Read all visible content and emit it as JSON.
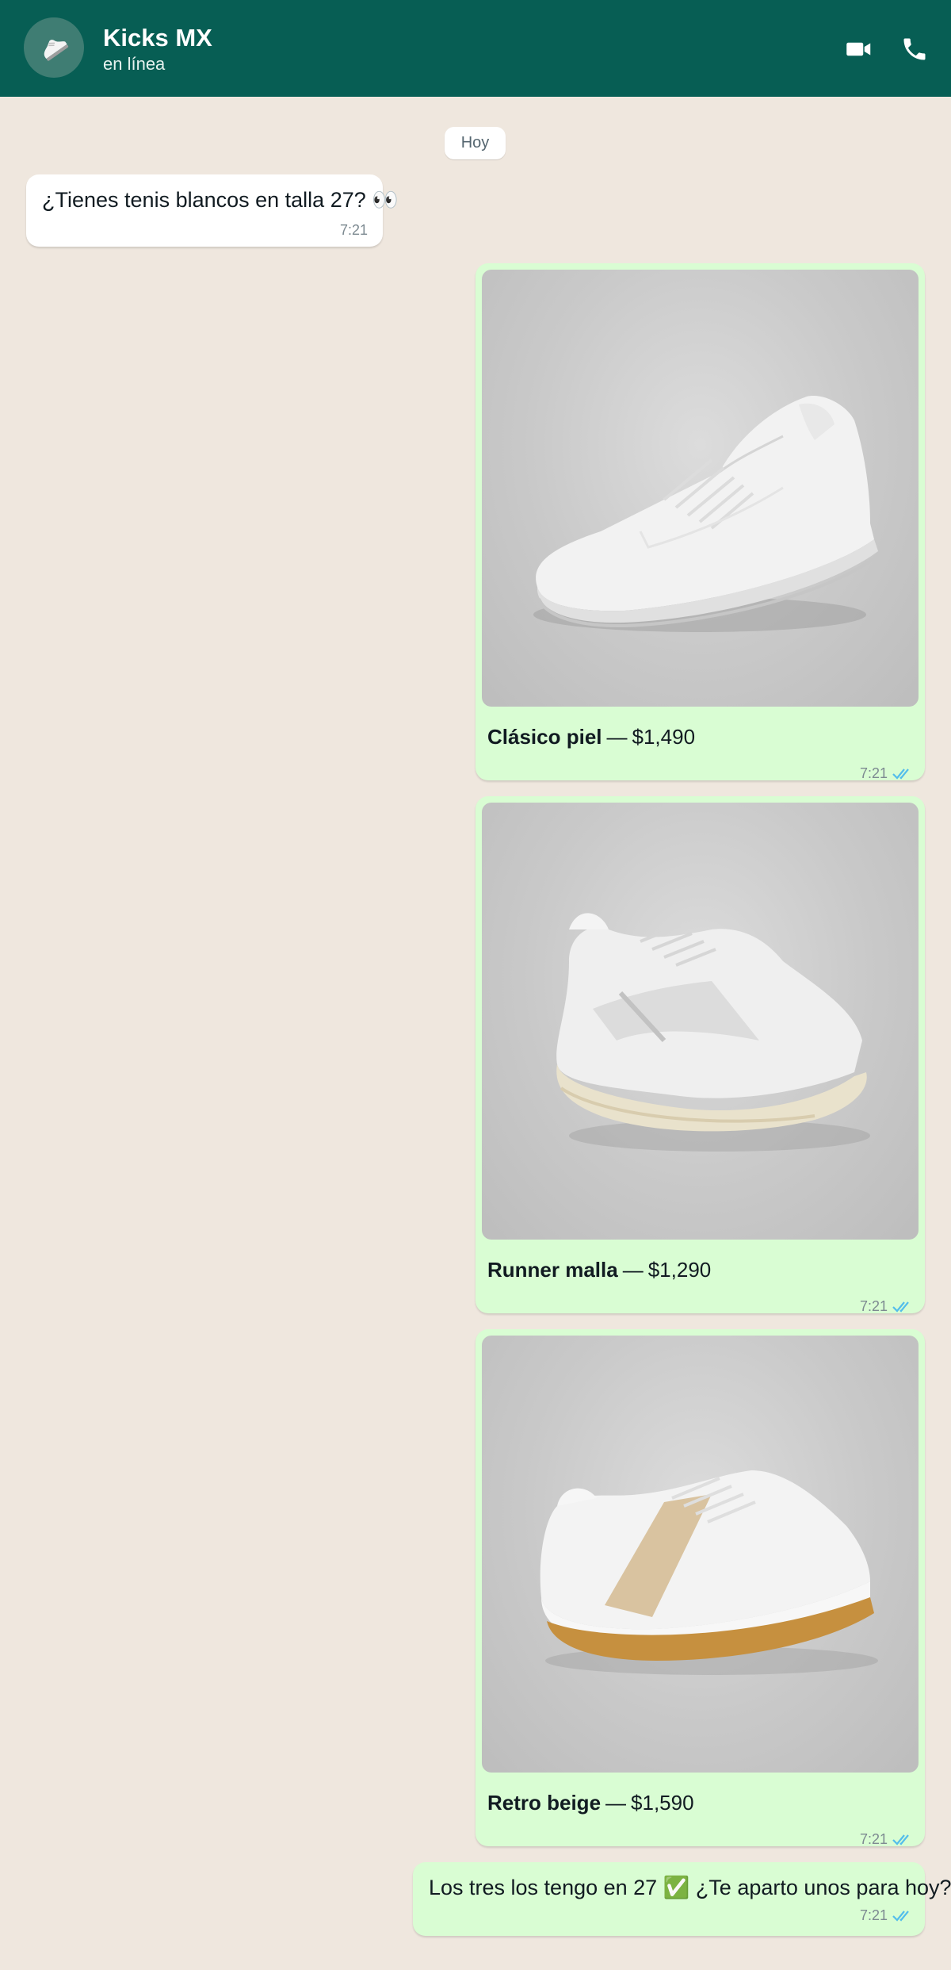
{
  "header": {
    "title": "Kicks MX",
    "status": "en línea",
    "icons": [
      "sneaker-avatar-icon",
      "video-call-icon",
      "phone-call-icon"
    ]
  },
  "chat": {
    "date_chip": "Hoy",
    "incoming": {
      "text": "¿Tienes tenis blancos en talla 27? 👀",
      "time": "7:21"
    },
    "products": [
      {
        "name": "Clásico piel",
        "dash": "—",
        "price": "$1,490",
        "time": "7:21",
        "read": true
      },
      {
        "name": "Runner malla",
        "dash": "—",
        "price": "$1,290",
        "time": "7:21",
        "read": true
      },
      {
        "name": "Retro beige",
        "dash": "—",
        "price": "$1,590",
        "time": "7:21",
        "read": true
      }
    ],
    "final": {
      "text": "Los tres los tengo en 27 ✅ ¿Te aparto unos para hoy?",
      "time": "7:21",
      "read": true
    }
  },
  "colors": {
    "header": "#075e54",
    "background": "#efe7de",
    "outgoing_bubble": "#d9fdd3",
    "incoming_bubble": "#ffffff",
    "read_ticks": "#53bdeb"
  }
}
